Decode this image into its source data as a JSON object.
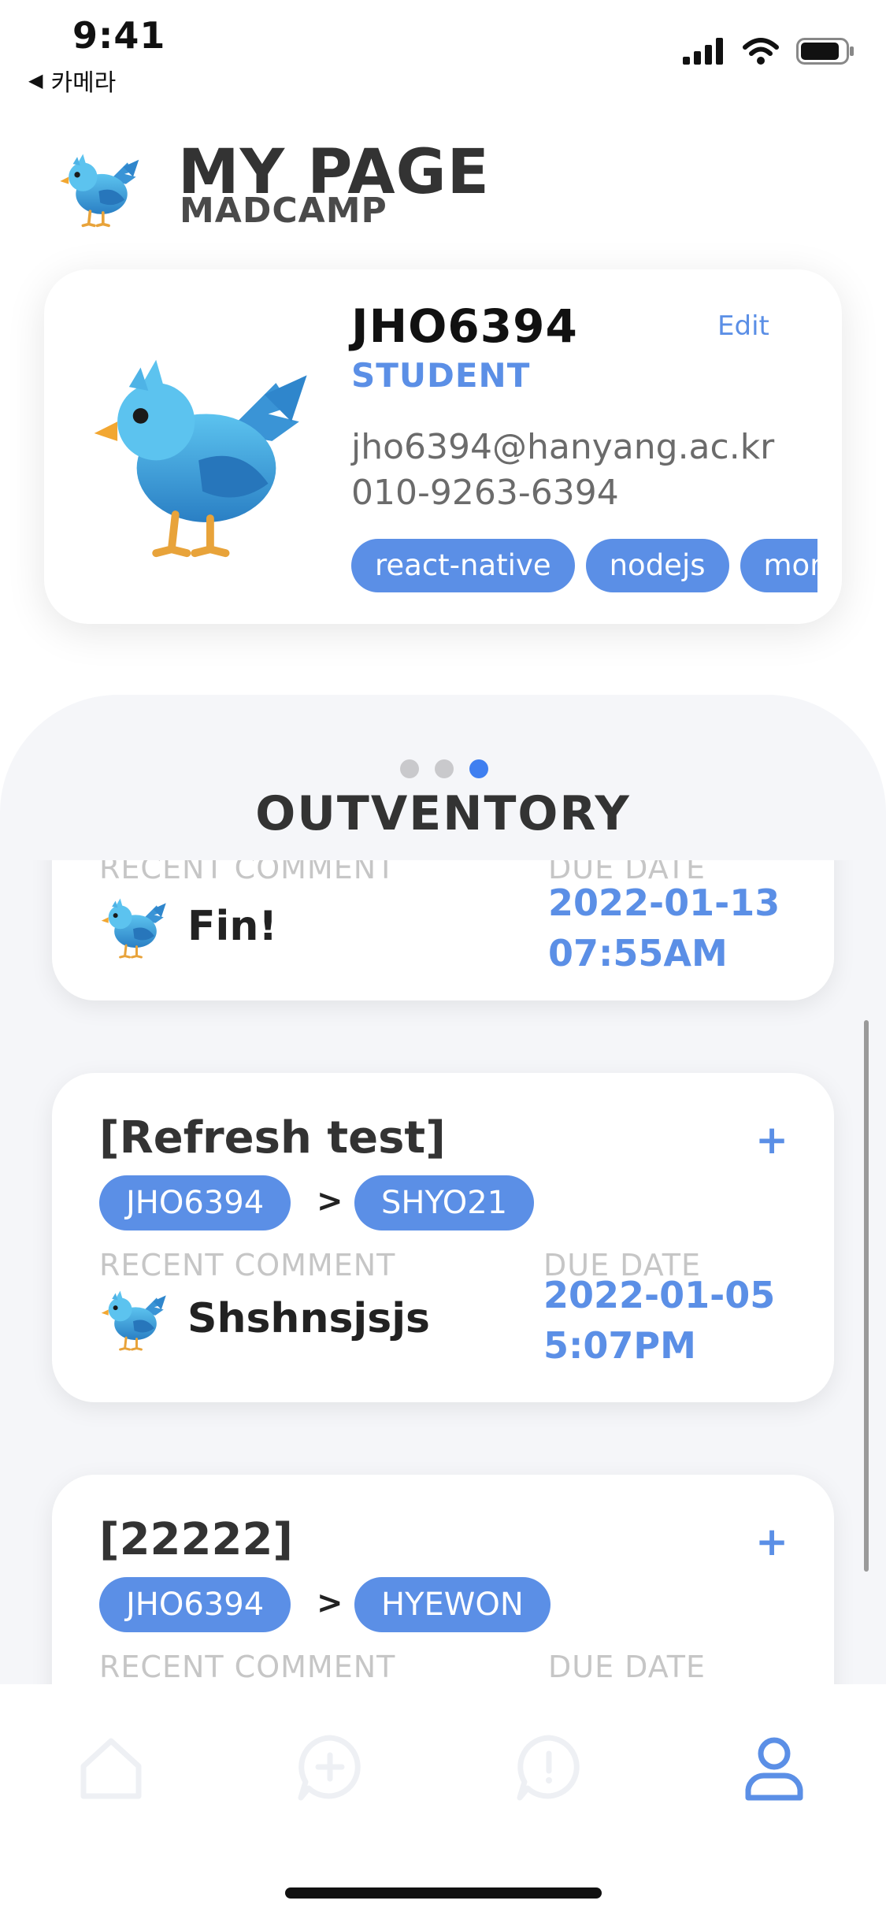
{
  "status_bar": {
    "time": "9:41",
    "back_label": "카메라"
  },
  "header": {
    "title": "MY PAGE",
    "subtitle": "MADCAMP"
  },
  "profile": {
    "name": "JHO6394",
    "role": "STUDENT",
    "edit_label": "Edit",
    "email": "jho6394@hanyang.ac.kr",
    "phone": "010-9263-6394",
    "tags": [
      "react-native",
      "nodejs",
      "mongodb"
    ]
  },
  "section": {
    "title": "OUTVENTORY",
    "page_dots": {
      "count": 3,
      "active_index": 2
    }
  },
  "labels": {
    "recent_comment": "RECENT COMMENT",
    "due_date": "DUE DATE"
  },
  "cards": [
    {
      "title": "",
      "from": "",
      "to": "",
      "comment": "Fin!",
      "due_date": "2022-01-13",
      "due_time": "07:55AM"
    },
    {
      "title": "[Refresh test]",
      "from": "JHO6394",
      "to": "SHYO21",
      "comment": "Shshnsjsjs",
      "due_date": "2022-01-05",
      "due_time": "5:07PM"
    },
    {
      "title": "[22222]",
      "from": "JHO6394",
      "to": "HYEWON",
      "comment": "",
      "due_date": "",
      "due_time": ""
    }
  ],
  "card_symbols": {
    "plus": "+",
    "arrow": ">"
  },
  "tabbar": {
    "tabs": [
      {
        "icon": "home-icon",
        "active": false
      },
      {
        "icon": "add-chat-icon",
        "active": false
      },
      {
        "icon": "alert-chat-icon",
        "active": false
      },
      {
        "icon": "profile-icon",
        "active": true
      }
    ],
    "active_color": "#5b8fe6",
    "inactive_color": "#f0f1f4"
  },
  "colors": {
    "accent": "#5b8fe6",
    "dot_active": "#3f7ff0",
    "dot_inactive": "#c9c9cc"
  }
}
